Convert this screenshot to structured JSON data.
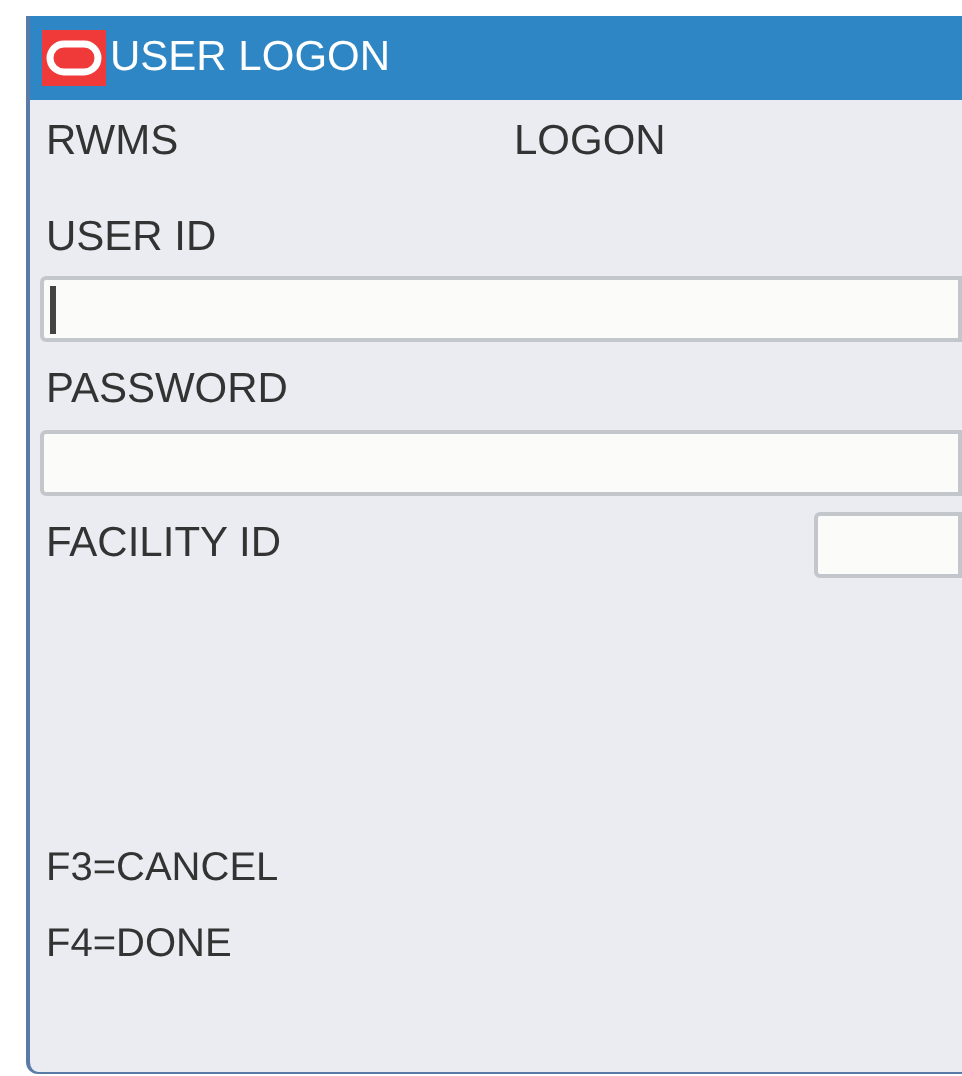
{
  "window": {
    "title": "USER LOGON"
  },
  "header": {
    "app": "RWMS",
    "screen": "LOGON"
  },
  "fields": [
    {
      "label": "USER ID",
      "kind": "wide",
      "focused": true
    },
    {
      "label": "PASSWORD",
      "kind": "wide",
      "focused": false
    },
    {
      "label": "FACILITY ID",
      "kind": "short",
      "focused": false
    }
  ],
  "keys": [
    "F3=CANCEL",
    "F4=DONE"
  ]
}
